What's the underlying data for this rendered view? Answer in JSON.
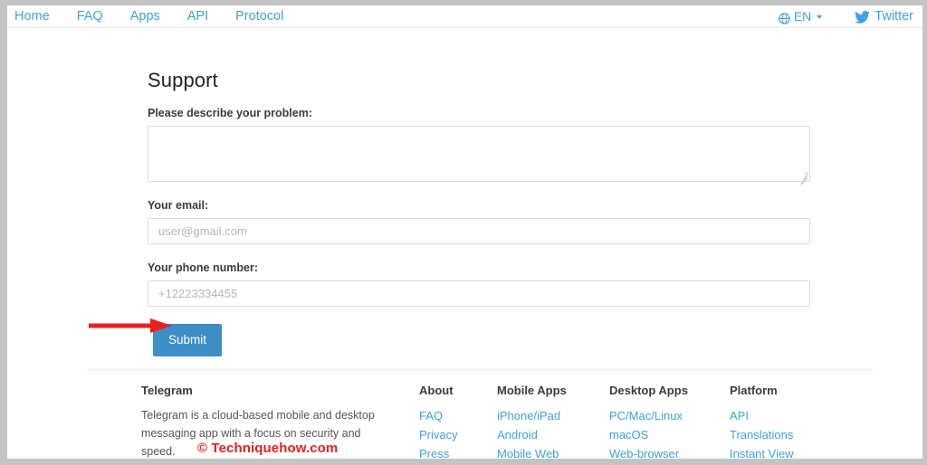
{
  "nav": {
    "links": [
      {
        "label": "Home"
      },
      {
        "label": "FAQ"
      },
      {
        "label": "Apps"
      },
      {
        "label": "API"
      },
      {
        "label": "Protocol"
      }
    ],
    "language": {
      "icon": "globe-icon",
      "label": "EN",
      "caret": "chevron-down-icon"
    },
    "twitter": {
      "icon": "twitter-bird-icon",
      "label": "Twitter"
    }
  },
  "main": {
    "title": "Support",
    "problem": {
      "label": "Please describe your problem:",
      "value": "",
      "placeholder": ""
    },
    "email": {
      "label": "Your email:",
      "value": "",
      "placeholder": "user@gmail.com"
    },
    "phone": {
      "label": "Your phone number:",
      "value": "",
      "placeholder": "+12223334455"
    },
    "submit_label": "Submit"
  },
  "annotation": {
    "arrow": "red-arrow-pointing-right",
    "color": "#f01c1c"
  },
  "footer": {
    "telegram": {
      "heading": "Telegram",
      "description": "Telegram is a cloud-based mobile and desktop messaging app with a focus on security and speed."
    },
    "about": {
      "heading": "About",
      "links": [
        "FAQ",
        "Privacy",
        "Press"
      ]
    },
    "mobile_apps": {
      "heading": "Mobile Apps",
      "links": [
        "iPhone/iPad",
        "Android",
        "Mobile Web"
      ]
    },
    "desktop_apps": {
      "heading": "Desktop Apps",
      "links": [
        "PC/Mac/Linux",
        "macOS",
        "Web-browser"
      ]
    },
    "platform": {
      "heading": "Platform",
      "links": [
        "API",
        "Translations",
        "Instant View"
      ]
    }
  },
  "watermark": {
    "text": "© Techniquehow.com"
  },
  "colors": {
    "link": "#3aa3e3",
    "button": "#3d8ec7",
    "annotation": "#f01c1c",
    "frame": "#c4c4c4"
  }
}
